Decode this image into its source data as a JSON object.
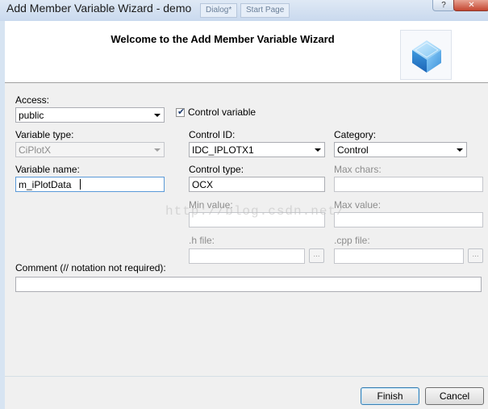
{
  "window": {
    "title": "Add Member Variable Wizard - demo",
    "bg_tabs": [
      "Dialog*",
      "Start Page"
    ]
  },
  "header": {
    "title": "Welcome to the Add Member Variable Wizard",
    "icon": "wizard-cube-icon"
  },
  "form": {
    "access": {
      "label": "Access:",
      "value": "public"
    },
    "control_variable": {
      "label": "Control variable",
      "checked": true
    },
    "variable_type": {
      "label": "Variable type:",
      "value": "CiPlotX"
    },
    "control_id": {
      "label": "Control ID:",
      "value": "IDC_IPLOTX1"
    },
    "category": {
      "label": "Category:",
      "value": "Control"
    },
    "variable_name": {
      "label": "Variable name:",
      "value": "m_iPlotData"
    },
    "control_type": {
      "label": "Control type:",
      "value": "OCX"
    },
    "max_chars": {
      "label": "Max chars:",
      "value": ""
    },
    "min_value": {
      "label": "Min value:",
      "value": ""
    },
    "max_value": {
      "label": "Max value:",
      "value": ""
    },
    "h_file": {
      "label": ".h file:",
      "value": "",
      "browse": "..."
    },
    "cpp_file": {
      "label": ".cpp file:",
      "value": "",
      "browse": "..."
    },
    "comment": {
      "label": "Comment (// notation not required):",
      "value": ""
    }
  },
  "watermark": "http://blog.csdn.net/",
  "buttons": {
    "finish": "Finish",
    "cancel": "Cancel"
  }
}
